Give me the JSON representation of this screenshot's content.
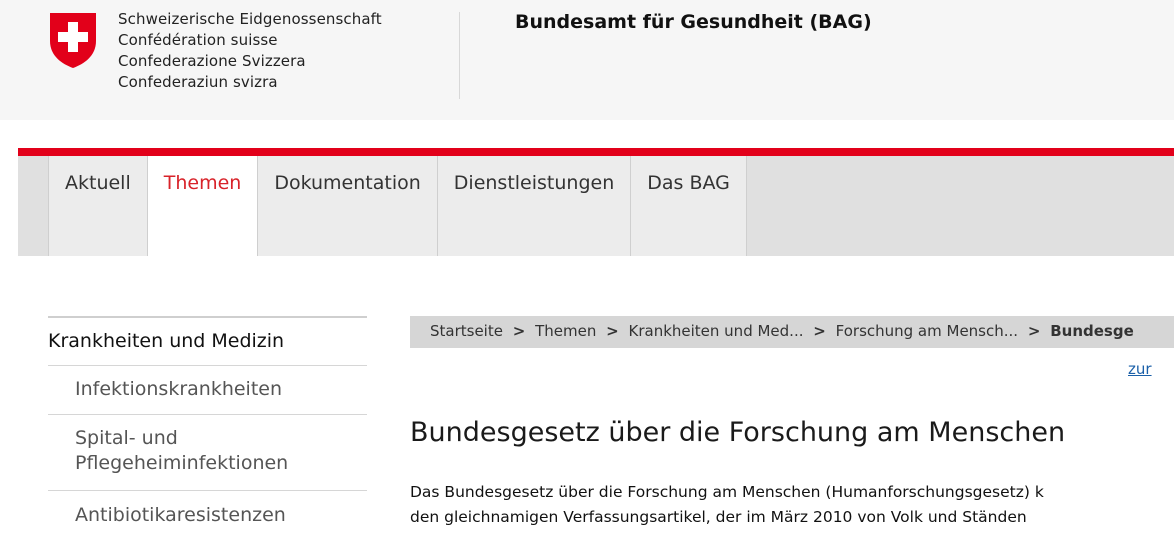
{
  "header": {
    "confederation": [
      "Schweizerische Eidgenossenschaft",
      "Confédération suisse",
      "Confederazione Svizzera",
      "Confederaziun svizra"
    ],
    "office": "Bundesamt für Gesundheit (BAG)"
  },
  "nav": {
    "tabs": [
      {
        "label": "Aktuell"
      },
      {
        "label": "Themen"
      },
      {
        "label": "Dokumentation"
      },
      {
        "label": "Dienstleistungen"
      },
      {
        "label": "Das BAG"
      }
    ],
    "active": "Themen"
  },
  "sidebar": {
    "heading": "Krankheiten und Medizin",
    "items": [
      {
        "label": "Infektionskrankheiten"
      },
      {
        "label": "Spital- und Pflegeheiminfektionen"
      },
      {
        "label": "Antibiotikaresistenzen"
      }
    ]
  },
  "breadcrumb": {
    "items": [
      "Startseite",
      "Themen",
      "Krankheiten und Med...",
      "Forschung am Mensch..."
    ],
    "current": "Bundesge",
    "separator": ">"
  },
  "content": {
    "back_link": "zur",
    "title": "Bundesgesetz über die Forschung am Menschen",
    "paragraph_lines": [
      "Das Bundesgesetz über die Forschung am Menschen (Humanforschungsgesetz) k",
      "den gleichnamigen Verfassungsartikel, der im März 2010 von Volk und Ständen"
    ]
  },
  "colors": {
    "accent_red": "#e2001a",
    "active_tab_text": "#d8232a",
    "link": "#1a5fa8"
  }
}
